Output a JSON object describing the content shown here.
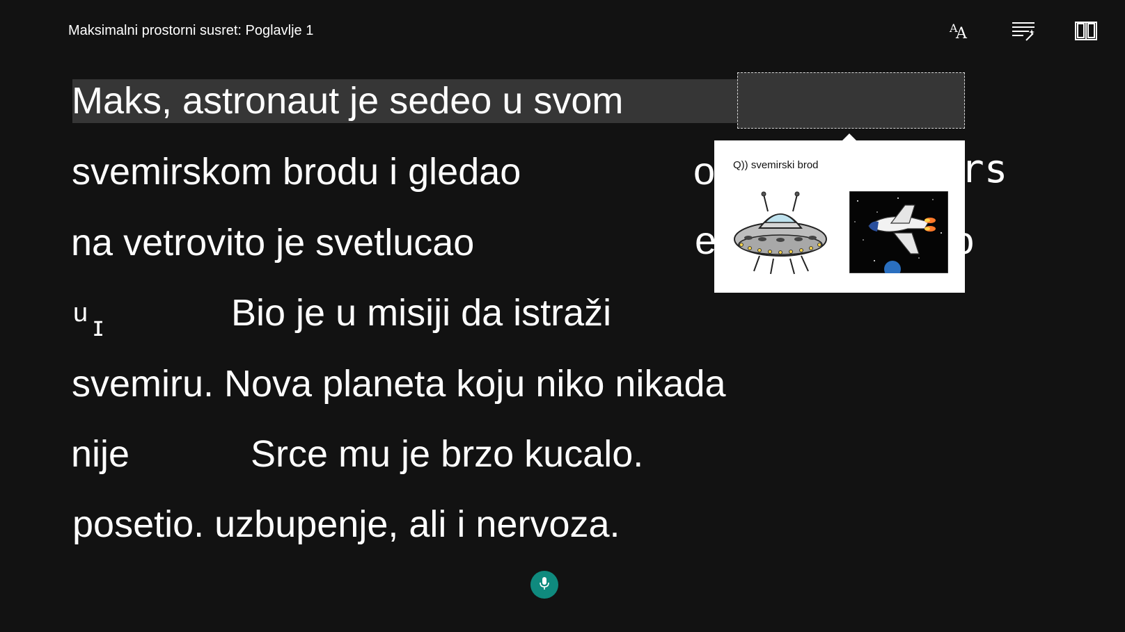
{
  "header": {
    "title": "Maksimalni prostorni susret: Poglavlje 1",
    "tools": [
      {
        "name": "text-size-icon"
      },
      {
        "name": "reading-preferences-icon"
      },
      {
        "name": "picture-dictionary-icon"
      }
    ]
  },
  "reader": {
    "lines": [
      "Maks, astronaut je sedeo u svom",
      "svemirskom brodu i gledao",
      "na vetrovito je svetlucao",
      "Bio je u misiji da istraži",
      "svemiru. Nova planeta koju niko nikada",
      "nije",
      "Srce mu je brzo kucalo.",
      "posetio. uzbupenje, ali i nervoza."
    ],
    "fragments": {
      "line2_right_a": "o",
      "line2_right_b": "rs",
      "line3_right_a": "e",
      "line3_right_b": "o",
      "line4_left": "u",
      "line4_left_mark": "ɪ"
    },
    "highlighted_line_index": 0
  },
  "popup": {
    "label": "Q)) svemirski brod",
    "images": [
      "ufo-picture",
      "space-shuttle-picture"
    ]
  },
  "footer": {
    "mic": "microphone-icon"
  },
  "colors": {
    "background": "#121212",
    "line_highlight": "#363636",
    "mic_button": "#0f8a7e"
  }
}
